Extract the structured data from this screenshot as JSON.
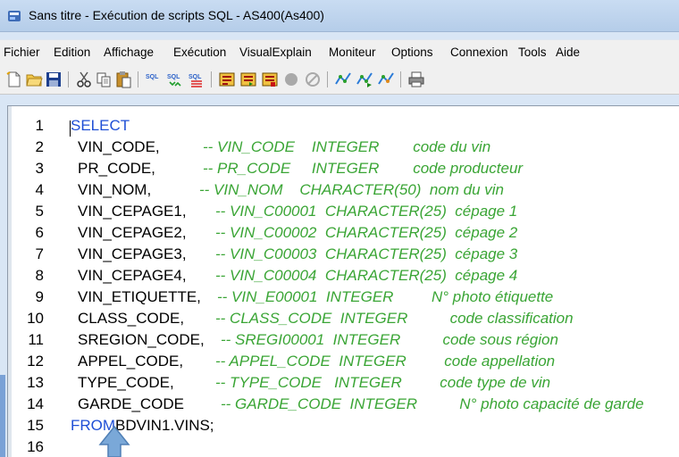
{
  "window": {
    "title": "Sans titre - Exécution de scripts SQL - AS400(As400)"
  },
  "menu": {
    "items": [
      "Fichier",
      "Edition",
      "Affichage",
      "Exécution",
      "VisualExplain",
      "Moniteur",
      "Options",
      "Connexion",
      "Tools",
      "Aide"
    ]
  },
  "toolbar": {
    "icons": [
      "new-icon",
      "open-icon",
      "save-icon",
      "cut-icon",
      "copy-icon",
      "paste-icon",
      "run-sql-icon",
      "run-sql-step-icon",
      "run-sql-all-icon",
      "explain-icon",
      "explain-run-icon",
      "explain-stop-icon",
      "stop-icon",
      "cancel-icon",
      "visual-explain-icon",
      "visual-explain-run-icon",
      "visual-explain-last-icon",
      "print-icon"
    ],
    "sql_label": "SQL"
  },
  "editor": {
    "lines": [
      {
        "num": "1",
        "kw": "SELECT",
        "ident": "",
        "comment": ""
      },
      {
        "num": "2",
        "kw": "",
        "ident": "VIN_CODE,",
        "comment": "-- VIN_CODE    INTEGER        code du vin"
      },
      {
        "num": "3",
        "kw": "",
        "ident": "PR_CODE,",
        "comment": "-- PR_CODE     INTEGER        code producteur"
      },
      {
        "num": "4",
        "kw": "",
        "ident": "VIN_NOM,",
        "comment": "-- VIN_NOM    CHARACTER(50)  nom du vin"
      },
      {
        "num": "5",
        "kw": "",
        "ident": "VIN_CEPAGE1,",
        "comment": "-- VIN_C00001  CHARACTER(25)  cépage 1"
      },
      {
        "num": "6",
        "kw": "",
        "ident": "VIN_CEPAGE2,",
        "comment": "-- VIN_C00002  CHARACTER(25)  cépage 2"
      },
      {
        "num": "7",
        "kw": "",
        "ident": "VIN_CEPAGE3,",
        "comment": "-- VIN_C00003  CHARACTER(25)  cépage 3"
      },
      {
        "num": "8",
        "kw": "",
        "ident": "VIN_CEPAGE4,",
        "comment": "-- VIN_C00004  CHARACTER(25)  cépage 4"
      },
      {
        "num": "9",
        "kw": "",
        "ident": "VIN_ETIQUETTE,",
        "comment": "-- VIN_E00001  INTEGER         N° photo étiquette"
      },
      {
        "num": "10",
        "kw": "",
        "ident": "CLASS_CODE,",
        "comment": "-- CLASS_CODE  INTEGER          code classification"
      },
      {
        "num": "11",
        "kw": "",
        "ident": "SREGION_CODE,",
        "comment": "-- SREGI00001  INTEGER          code sous région"
      },
      {
        "num": "12",
        "kw": "",
        "ident": "APPEL_CODE,",
        "comment": "-- APPEL_CODE  INTEGER         code appellation"
      },
      {
        "num": "13",
        "kw": "",
        "ident": "TYPE_CODE,",
        "comment": "-- TYPE_CODE   INTEGER         code type de vin"
      },
      {
        "num": "14",
        "kw": "",
        "ident": "GARDE_CODE",
        "comment": "-- GARDE_CODE  INTEGER          N° photo capacité de garde"
      },
      {
        "num": "15",
        "kw": "FROM",
        "ident": "BDVIN1.VINS;",
        "comment": ""
      },
      {
        "num": "16",
        "kw": "",
        "ident": "",
        "comment": ""
      }
    ]
  },
  "colors": {
    "keyword": "#1f4fd6",
    "comment": "#3aa535",
    "title_bar": "#c9dcf2"
  }
}
